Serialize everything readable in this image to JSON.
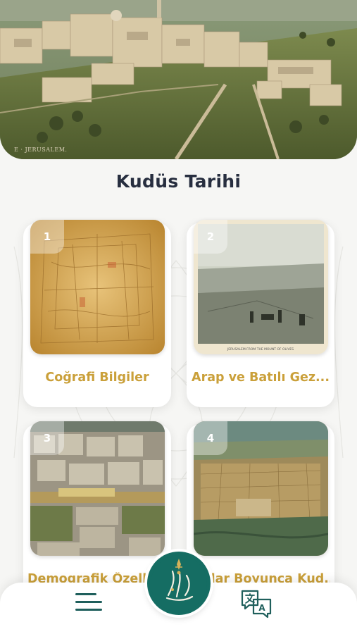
{
  "hero": {
    "caption": "E · JERUSALEM."
  },
  "page": {
    "title": "Kudüs Tarihi"
  },
  "cards": [
    {
      "number": "1",
      "label": "Coğrafi Bilgiler"
    },
    {
      "number": "2",
      "label": "Arap ve Batılı Gez..."
    },
    {
      "number": "3",
      "label": "Demografik Özellikl..."
    },
    {
      "number": "4",
      "label": "...rlar Boyunca Kud..."
    }
  ],
  "nav": {
    "menu_icon": "menu-icon",
    "translate_icon": "translate-icon",
    "logo_icon": "calligraphy-logo-icon"
  },
  "colors": {
    "title": "#272e3f",
    "card_label": "#caa03a",
    "brand_teal": "#156d63",
    "icon_teal": "#1f5f5c"
  }
}
